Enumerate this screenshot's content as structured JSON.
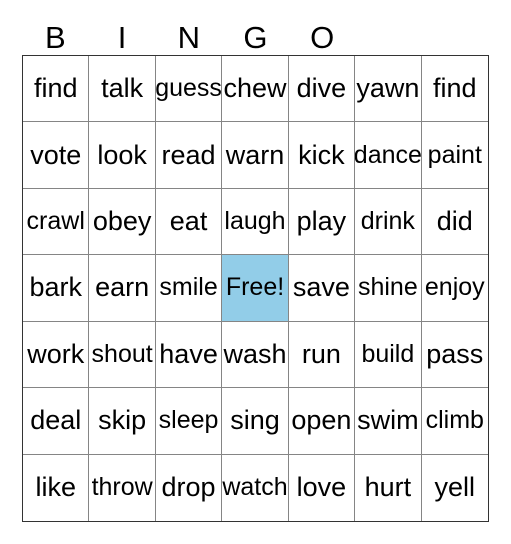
{
  "card": {
    "title": "BINGO",
    "header_letters": [
      "B",
      "I",
      "N",
      "G",
      "O",
      "",
      ""
    ],
    "columns": 7,
    "rows": 7,
    "free_space_label": "Free!",
    "free_space_row": 4,
    "free_space_col": 4,
    "free_space_color": "#92cde8",
    "border_color": "#858585",
    "outer_border_color": "#333333",
    "text_color": "#000000",
    "background_color": "#ffffff"
  },
  "grid": [
    [
      "find",
      "talk",
      "guess",
      "chew",
      "dive",
      "yawn",
      "find"
    ],
    [
      "vote",
      "look",
      "read",
      "warn",
      "kick",
      "dance",
      "paint"
    ],
    [
      "crawl",
      "obey",
      "eat",
      "laugh",
      "play",
      "drink",
      "did"
    ],
    [
      "bark",
      "earn",
      "smile",
      "Free!",
      "save",
      "shine",
      "enjoy"
    ],
    [
      "work",
      "shout",
      "have",
      "wash",
      "run",
      "build",
      "pass"
    ],
    [
      "deal",
      "skip",
      "sleep",
      "sing",
      "open",
      "swim",
      "climb"
    ],
    [
      "like",
      "throw",
      "drop",
      "watch",
      "love",
      "hurt",
      "yell"
    ]
  ]
}
